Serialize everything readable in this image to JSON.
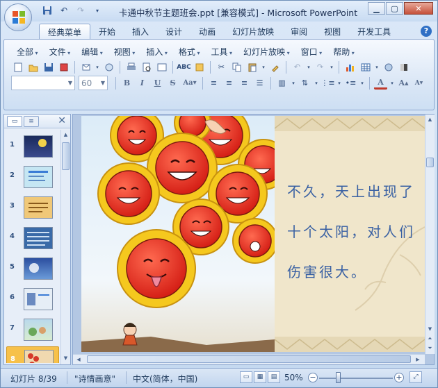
{
  "window": {
    "title": "卡通中秋节主题班会.ppt [兼容模式] - Microsoft PowerPoint",
    "controls": [
      "minimize",
      "maximize",
      "close"
    ]
  },
  "quick_access": [
    {
      "icon": "save-icon"
    },
    {
      "icon": "undo-icon"
    },
    {
      "icon": "redo-icon"
    },
    {
      "icon": "customize-chevron-icon"
    }
  ],
  "ribbon_tabs": [
    "经典菜单",
    "开始",
    "插入",
    "设计",
    "动画",
    "幻灯片放映",
    "审阅",
    "视图",
    "开发工具"
  ],
  "active_tab": "经典菜单",
  "classic_menus": [
    "全部",
    "文件",
    "编辑",
    "视图",
    "插入",
    "格式",
    "工具",
    "幻灯片放映",
    "窗口",
    "帮助"
  ],
  "font_combo": {
    "value": ""
  },
  "size_combo": {
    "value": "60"
  },
  "slides_panel": {
    "thumbnails": [
      {
        "number": "1",
        "color": "#1a2a5c"
      },
      {
        "number": "2",
        "color": "#9fd4ea"
      },
      {
        "number": "3",
        "color": "#f0c878"
      },
      {
        "number": "4",
        "color": "#3a6aa8"
      },
      {
        "number": "5",
        "color": "#3c5fb0"
      },
      {
        "number": "6",
        "color": "#dfe8f0"
      },
      {
        "number": "7",
        "color": "#b9d9ec"
      },
      {
        "number": "8",
        "color": "#f0d9b0"
      }
    ],
    "selected": "8"
  },
  "slide": {
    "text": "不久，天上出现了十个太阳，对人们伤害很大。"
  },
  "status": {
    "slide_counter": "幻灯片 8/39",
    "theme": "\"诗情画意\"",
    "language": "中文(简体，中国)",
    "zoom": "50%",
    "zoom_level": 0.5
  }
}
